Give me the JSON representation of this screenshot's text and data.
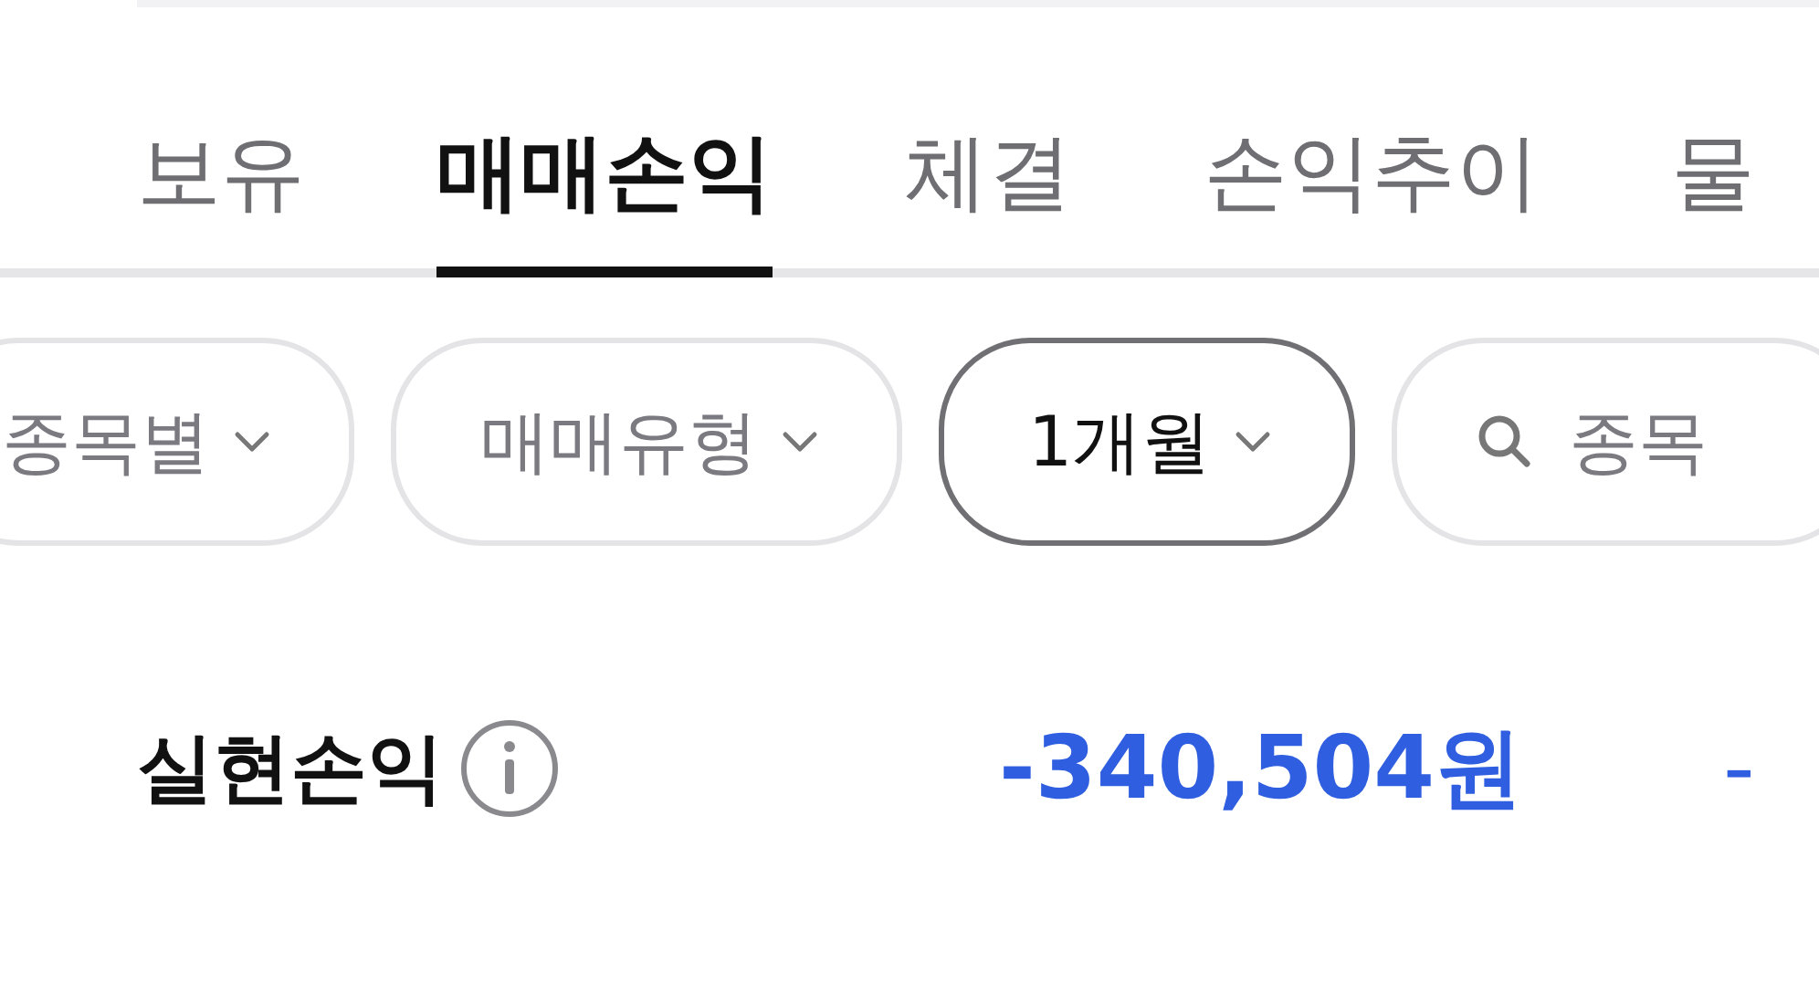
{
  "tabs": [
    {
      "label": "보유",
      "selected": false
    },
    {
      "label": "매매손익",
      "selected": true
    },
    {
      "label": "체결",
      "selected": false
    },
    {
      "label": "손익추이",
      "selected": false
    },
    {
      "label": "물",
      "selected": false
    }
  ],
  "filters": [
    {
      "kind": "dropdown",
      "label": "종목별",
      "selected": false
    },
    {
      "kind": "dropdown",
      "label": "매매유형",
      "selected": false
    },
    {
      "kind": "dropdown",
      "label": "1개월",
      "selected": true
    },
    {
      "kind": "search",
      "placeholder": "종목"
    }
  ],
  "summary": {
    "label": "실현손익",
    "value": "-340,504원",
    "next_value": "-"
  }
}
